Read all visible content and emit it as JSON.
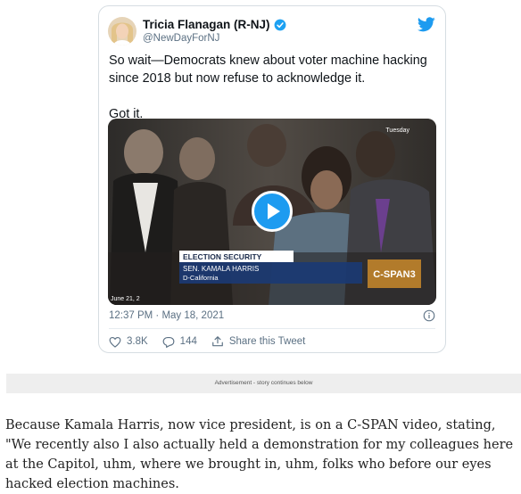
{
  "tweet": {
    "author_name": "Tricia Flanagan (R-NJ)",
    "handle": "@NewDayForNJ",
    "text_lines": [
      "So wait—Democrats knew about voter machine hacking since 2018 but now refuse to acknowledge it.",
      "Got it."
    ],
    "timestamp": "12:37 PM · May 18, 2021",
    "likes": "3.8K",
    "replies": "144",
    "share_label": "Share this Tweet",
    "video": {
      "corner_label": "Tuesday",
      "lower_third_heading": "ELECTION SECURITY",
      "lower_third_name": "SEN. KAMALA HARRIS",
      "lower_third_party": "D-California",
      "channel_logo": "C-SPAN3",
      "date_stamp": "June 21, 2"
    }
  },
  "ad": {
    "label": "Advertisement - story continues below"
  },
  "article": {
    "paragraph": "Because Kamala Harris, now vice president, is on a C-SPAN video, stating, \"We recently also I also actually held a demonstration for my colleagues here at the Capitol, uhm, where we brought in, uhm, folks who before our eyes hacked election machines."
  },
  "colors": {
    "twitter_blue": "#1d9bf0",
    "verified_blue": "#1da1f2",
    "text_primary": "#0f1419",
    "text_secondary": "#5b7083",
    "ad_background": "#eeeeee"
  },
  "icons": [
    "avatar",
    "verified-badge-icon",
    "twitter-bird-icon",
    "play-icon",
    "info-icon",
    "heart-icon",
    "reply-icon",
    "share-icon"
  ]
}
